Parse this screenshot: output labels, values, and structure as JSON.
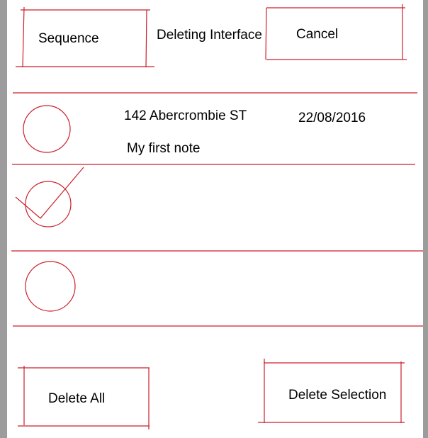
{
  "header": {
    "sequence_label": "Sequence",
    "title": "Deleting Interface",
    "cancel_label": "Cancel"
  },
  "notes": [
    {
      "address": "142 Abercrombie ST",
      "date": "22/08/2016",
      "text": "My first note",
      "selected": false
    },
    {
      "address": "",
      "date": "",
      "text": "",
      "selected": true
    },
    {
      "address": "",
      "date": "",
      "text": "",
      "selected": false
    }
  ],
  "footer": {
    "delete_all_label": "Delete All",
    "delete_selection_label": "Delete Selection"
  },
  "colors": {
    "sketch": "#cc1f2a",
    "background": "#ffffff",
    "frame": "#9c9c9c"
  }
}
